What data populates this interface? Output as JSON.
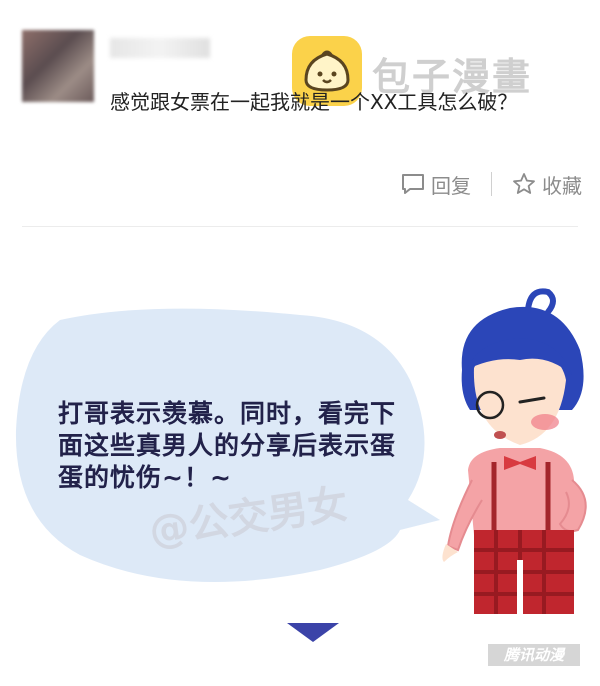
{
  "post": {
    "comment": "感觉跟女票在一起我就是一个XX工具怎么破？",
    "reply_label": "回复",
    "favorite_label": "收藏"
  },
  "watermark": {
    "text": "包子漫畫"
  },
  "comic": {
    "bubble_text": "打哥表示羡慕。同时，看完下面这些真男人的分享后表示蛋蛋的忧伤~！~",
    "credit_text": "@公交男女",
    "publisher_logo": "腾讯动漫"
  },
  "colors": {
    "bubble_fill": "#dde9f7",
    "hair": "#2b46b8",
    "shirt": "#f4a3a6",
    "pants": "#c0262e",
    "arrow": "#3b43a8",
    "watermark_yellow": "#fbd24a"
  },
  "icons": [
    "comment-icon",
    "star-icon",
    "chevron-down-icon"
  ]
}
